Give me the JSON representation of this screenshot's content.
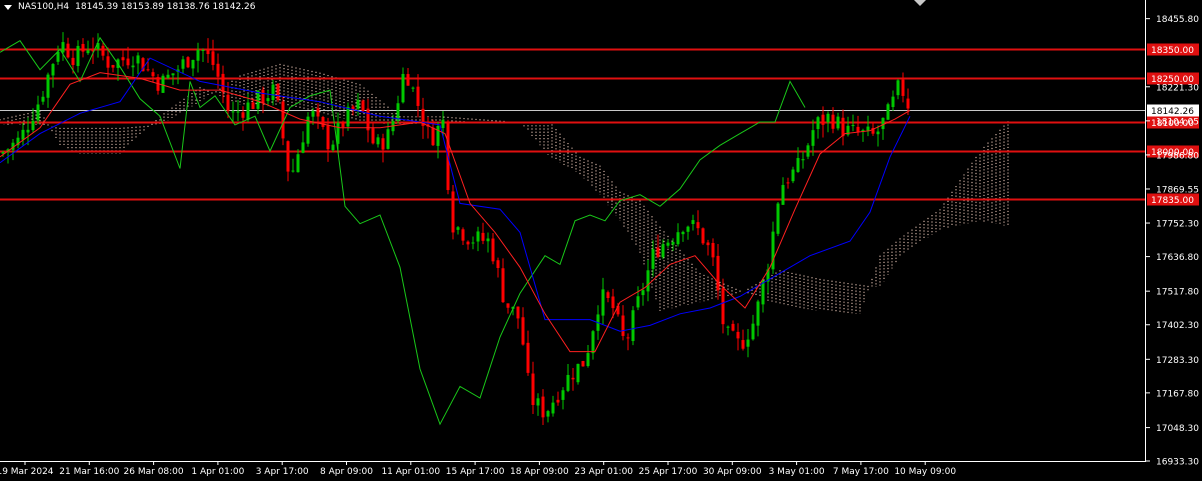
{
  "window": {
    "symbol_line": "NAS100,H4",
    "ohlc": "18145.39 18153.89 18138.76 18142.26"
  },
  "colors": {
    "background": "#000000",
    "bull": "#00c800",
    "bear": "#ff0000",
    "level": "#e01010",
    "tenkan": "#ff2020",
    "kijun": "#0000ff",
    "chikou": "#19c819",
    "cloud": "#f5d0c0",
    "axis_text": "#ffffff"
  },
  "chart_data": {
    "type": "line",
    "title": "NAS100,H4",
    "ylim": [
      16933.3,
      18520
    ],
    "y_ticks": [
      "18455.80",
      "18221.30",
      "18104.05",
      "17986.80",
      "17869.55",
      "17752.30",
      "17636.80",
      "17517.80",
      "17402.30",
      "17283.30",
      "17167.80",
      "17048.30",
      "16933.30"
    ],
    "x_ticks": [
      "19 Mar 2024",
      "21 Mar 16:00",
      "26 Mar 08:00",
      "1 Apr 01:00",
      "3 Apr 17:00",
      "8 Apr 09:00",
      "11 Apr 01:00",
      "15 Apr 17:00",
      "18 Apr 09:00",
      "23 Apr 01:00",
      "25 Apr 17:00",
      "30 Apr 09:00",
      "3 May 01:00",
      "7 May 17:00",
      "10 May 09:00"
    ],
    "levels": [
      {
        "price": 18350.0,
        "label": "18350.00"
      },
      {
        "price": 18250.0,
        "label": "18250.00"
      },
      {
        "price": 18100.0,
        "label": "18100.00"
      },
      {
        "price": 18000.0,
        "label": "18000.00"
      },
      {
        "price": 17835.0,
        "label": "17835.00"
      }
    ],
    "current_price": {
      "value": 18142.26,
      "label": "18142.26"
    },
    "price_path": [
      [
        0,
        17990
      ],
      [
        20,
        18040
      ],
      [
        40,
        18180
      ],
      [
        60,
        18380
      ],
      [
        75,
        18320
      ],
      [
        90,
        18370
      ],
      [
        110,
        18300
      ],
      [
        135,
        18330
      ],
      [
        160,
        18230
      ],
      [
        180,
        18290
      ],
      [
        200,
        18360
      ],
      [
        215,
        18290
      ],
      [
        230,
        18120
      ],
      [
        250,
        18160
      ],
      [
        275,
        18210
      ],
      [
        290,
        17900
      ],
      [
        310,
        18140
      ],
      [
        330,
        18020
      ],
      [
        345,
        18110
      ],
      [
        360,
        18160
      ],
      [
        375,
        18010
      ],
      [
        390,
        18060
      ],
      [
        405,
        18290
      ],
      [
        420,
        18140
      ],
      [
        430,
        18040
      ],
      [
        445,
        18110
      ],
      [
        450,
        17760
      ],
      [
        470,
        17700
      ],
      [
        490,
        17690
      ],
      [
        505,
        17480
      ],
      [
        520,
        17420
      ],
      [
        530,
        17150
      ],
      [
        545,
        17100
      ],
      [
        560,
        17180
      ],
      [
        570,
        17230
      ],
      [
        585,
        17280
      ],
      [
        600,
        17500
      ],
      [
        612,
        17470
      ],
      [
        625,
        17330
      ],
      [
        640,
        17500
      ],
      [
        655,
        17660
      ],
      [
        670,
        17700
      ],
      [
        685,
        17760
      ],
      [
        700,
        17720
      ],
      [
        712,
        17640
      ],
      [
        725,
        17370
      ],
      [
        740,
        17330
      ],
      [
        755,
        17420
      ],
      [
        770,
        17650
      ],
      [
        780,
        17880
      ],
      [
        800,
        17950
      ],
      [
        815,
        18090
      ],
      [
        830,
        18120
      ],
      [
        845,
        18070
      ],
      [
        860,
        18060
      ],
      [
        875,
        18050
      ],
      [
        890,
        18140
      ],
      [
        900,
        18230
      ],
      [
        910,
        18145
      ]
    ],
    "tenkan_path": [
      [
        0,
        17980
      ],
      [
        40,
        18080
      ],
      [
        70,
        18230
      ],
      [
        100,
        18270
      ],
      [
        140,
        18250
      ],
      [
        180,
        18210
      ],
      [
        220,
        18210
      ],
      [
        260,
        18170
      ],
      [
        300,
        18110
      ],
      [
        340,
        18080
      ],
      [
        380,
        18080
      ],
      [
        420,
        18100
      ],
      [
        445,
        18060
      ],
      [
        470,
        17820
      ],
      [
        495,
        17720
      ],
      [
        520,
        17600
      ],
      [
        545,
        17440
      ],
      [
        570,
        17310
      ],
      [
        595,
        17310
      ],
      [
        620,
        17480
      ],
      [
        645,
        17530
      ],
      [
        670,
        17610
      ],
      [
        695,
        17640
      ],
      [
        720,
        17540
      ],
      [
        745,
        17460
      ],
      [
        770,
        17600
      ],
      [
        795,
        17800
      ],
      [
        820,
        17990
      ],
      [
        845,
        18060
      ],
      [
        870,
        18070
      ],
      [
        895,
        18110
      ],
      [
        910,
        18140
      ]
    ],
    "kijun_path": [
      [
        0,
        17960
      ],
      [
        40,
        18060
      ],
      [
        80,
        18130
      ],
      [
        120,
        18170
      ],
      [
        150,
        18320
      ],
      [
        200,
        18240
      ],
      [
        260,
        18200
      ],
      [
        320,
        18170
      ],
      [
        380,
        18120
      ],
      [
        440,
        18090
      ],
      [
        460,
        17820
      ],
      [
        500,
        17800
      ],
      [
        520,
        17720
      ],
      [
        545,
        17420
      ],
      [
        590,
        17420
      ],
      [
        620,
        17380
      ],
      [
        650,
        17400
      ],
      [
        680,
        17440
      ],
      [
        710,
        17460
      ],
      [
        740,
        17500
      ],
      [
        770,
        17560
      ],
      [
        810,
        17640
      ],
      [
        850,
        17690
      ],
      [
        870,
        17790
      ],
      [
        890,
        17980
      ],
      [
        910,
        18120
      ]
    ],
    "chikou_path": [
      [
        0,
        18340
      ],
      [
        20,
        18380
      ],
      [
        40,
        18280
      ],
      [
        60,
        18350
      ],
      [
        80,
        18240
      ],
      [
        100,
        18390
      ],
      [
        120,
        18290
      ],
      [
        140,
        18180
      ],
      [
        160,
        18120
      ],
      [
        180,
        17940
      ],
      [
        190,
        18240
      ],
      [
        200,
        18150
      ],
      [
        215,
        18190
      ],
      [
        235,
        18090
      ],
      [
        255,
        18120
      ],
      [
        270,
        18000
      ],
      [
        290,
        18150
      ],
      [
        310,
        18190
      ],
      [
        330,
        18210
      ],
      [
        345,
        17810
      ],
      [
        360,
        17750
      ],
      [
        380,
        17780
      ],
      [
        400,
        17600
      ],
      [
        420,
        17250
      ],
      [
        440,
        17060
      ],
      [
        460,
        17190
      ],
      [
        480,
        17150
      ],
      [
        500,
        17360
      ],
      [
        520,
        17510
      ],
      [
        545,
        17640
      ],
      [
        560,
        17610
      ],
      [
        575,
        17760
      ],
      [
        590,
        17780
      ],
      [
        605,
        17760
      ],
      [
        620,
        17830
      ],
      [
        640,
        17850
      ],
      [
        660,
        17810
      ],
      [
        680,
        17870
      ],
      [
        700,
        17970
      ],
      [
        720,
        18020
      ],
      [
        740,
        18060
      ],
      [
        760,
        18100
      ],
      [
        775,
        18100
      ],
      [
        790,
        18240
      ],
      [
        800,
        18180
      ],
      [
        805,
        18150
      ]
    ],
    "cloud": [
      [
        0,
        18090,
        18110
      ],
      [
        40,
        18090,
        18140
      ],
      [
        60,
        18080,
        18020
      ],
      [
        80,
        18080,
        17990
      ],
      [
        120,
        18080,
        17990
      ],
      [
        160,
        18090,
        18120
      ],
      [
        200,
        18170,
        18220
      ],
      [
        240,
        18260,
        18160
      ],
      [
        280,
        18300,
        18160
      ],
      [
        320,
        18270,
        18130
      ],
      [
        360,
        18230,
        18100
      ],
      [
        400,
        18120,
        18090
      ],
      [
        440,
        18120,
        18100
      ],
      [
        480,
        18110,
        18100
      ],
      [
        520,
        18100,
        18100
      ],
      [
        550,
        17980,
        18100
      ],
      [
        580,
        17920,
        17980
      ],
      [
        600,
        17850,
        17950
      ],
      [
        620,
        17760,
        17860
      ],
      [
        640,
        17650,
        17830
      ],
      [
        660,
        17450,
        17740
      ],
      [
        700,
        17480,
        17580
      ],
      [
        740,
        17510,
        17520
      ],
      [
        780,
        17590,
        17470
      ],
      [
        820,
        17560,
        17450
      ],
      [
        860,
        17540,
        17440
      ],
      [
        880,
        17530,
        17640
      ],
      [
        900,
        17640,
        17700
      ],
      [
        940,
        17730,
        17800
      ],
      [
        980,
        17760,
        18000
      ],
      [
        1010,
        17740,
        18110
      ]
    ]
  }
}
